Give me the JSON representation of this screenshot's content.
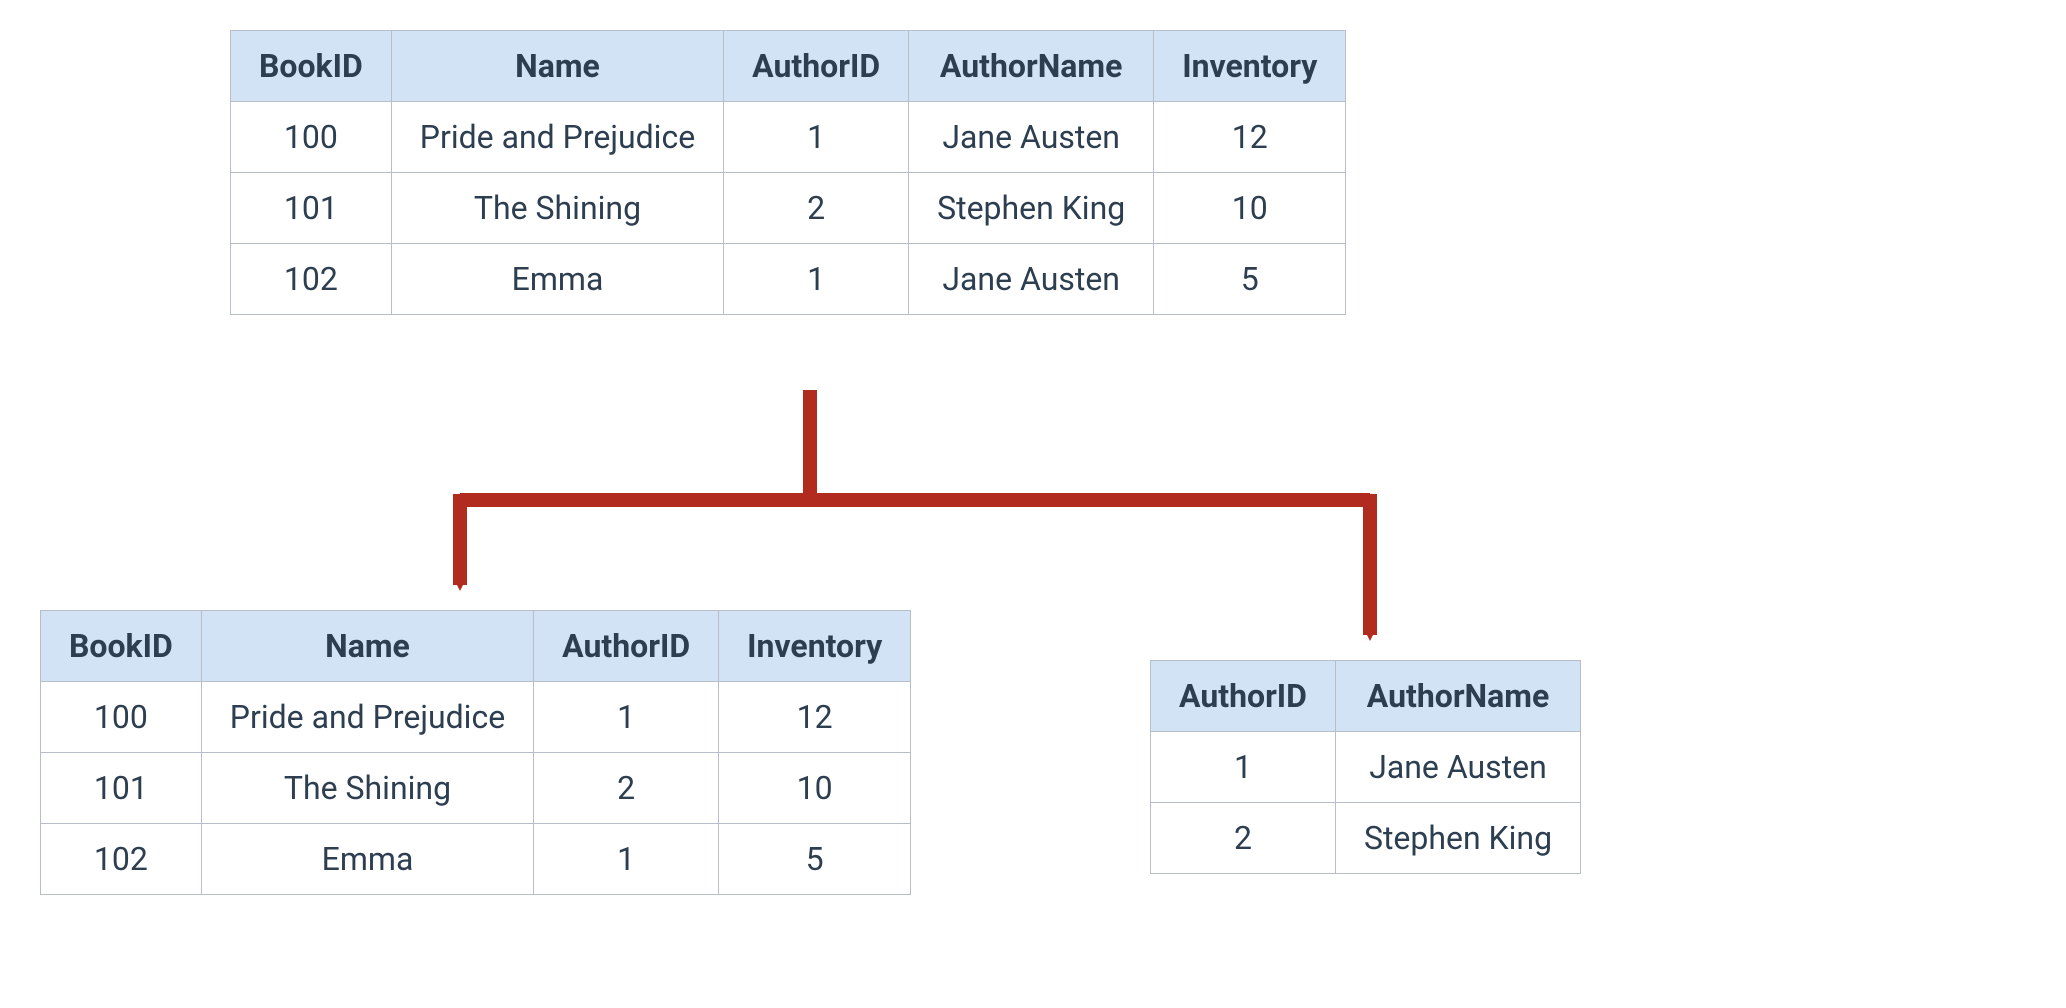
{
  "tables": {
    "top": {
      "headers": [
        "BookID",
        "Name",
        "AuthorID",
        "AuthorName",
        "Inventory"
      ],
      "rows": [
        [
          "100",
          "Pride and Prejudice",
          "1",
          "Jane Austen",
          "12"
        ],
        [
          "101",
          "The Shining",
          "2",
          "Stephen King",
          "10"
        ],
        [
          "102",
          "Emma",
          "1",
          "Jane Austen",
          "5"
        ]
      ]
    },
    "left": {
      "headers": [
        "BookID",
        "Name",
        "AuthorID",
        "Inventory"
      ],
      "rows": [
        [
          "100",
          "Pride and Prejudice",
          "1",
          "12"
        ],
        [
          "101",
          "The Shining",
          "2",
          "10"
        ],
        [
          "102",
          "Emma",
          "1",
          "5"
        ]
      ]
    },
    "right": {
      "headers": [
        "AuthorID",
        "AuthorName"
      ],
      "rows": [
        [
          "1",
          "Jane Austen"
        ],
        [
          "2",
          "Stephen King"
        ]
      ]
    }
  },
  "colors": {
    "header_bg": "#d1e3f5",
    "border": "#b7bec7",
    "text": "#2c3e50",
    "arrow": "#B22B1F"
  }
}
